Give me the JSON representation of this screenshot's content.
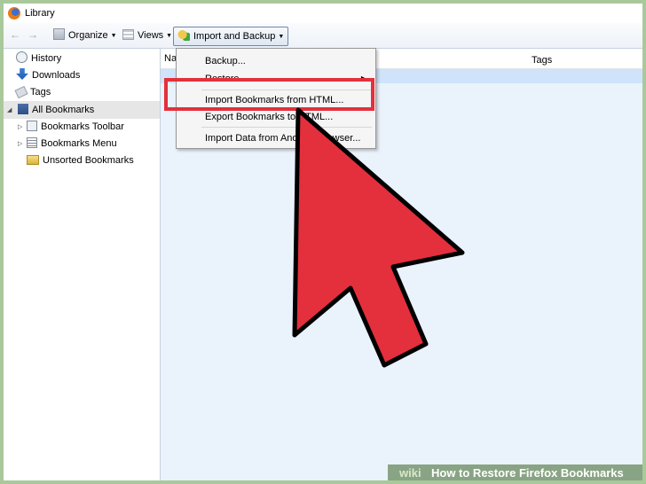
{
  "window": {
    "title": "Library"
  },
  "toolbar": {
    "organize": "Organize",
    "views": "Views",
    "import_backup": "Import and Backup"
  },
  "sidebar": {
    "items": [
      {
        "label": "History",
        "icon": "history-icon"
      },
      {
        "label": "Downloads",
        "icon": "downloads-icon"
      },
      {
        "label": "Tags",
        "icon": "tags-icon"
      },
      {
        "label": "All Bookmarks",
        "icon": "all-bookmarks-icon",
        "selected": true
      },
      {
        "label": "Bookmarks Toolbar",
        "icon": "bookmarks-toolbar-icon"
      },
      {
        "label": "Bookmarks Menu",
        "icon": "bookmarks-menu-icon"
      },
      {
        "label": "Unsorted Bookmarks",
        "icon": "unsorted-bookmarks-icon"
      }
    ]
  },
  "content": {
    "columns": {
      "name": "Na",
      "tags": "Tags"
    }
  },
  "menu": {
    "items": [
      {
        "label": "Backup..."
      },
      {
        "label": "Restore"
      },
      {
        "label": "Import Bookmarks from HTML..."
      },
      {
        "label": "Export Bookmarks to HTML..."
      },
      {
        "label": "Import Data from Another Browser..."
      }
    ]
  },
  "watermark": {
    "brand": "wiki",
    "text": "How to Restore Firefox Bookmarks"
  },
  "colors": {
    "annotation_red": "#e3303c",
    "selection_blue": "#cfe3fb",
    "background_green": "#a9c99a"
  }
}
